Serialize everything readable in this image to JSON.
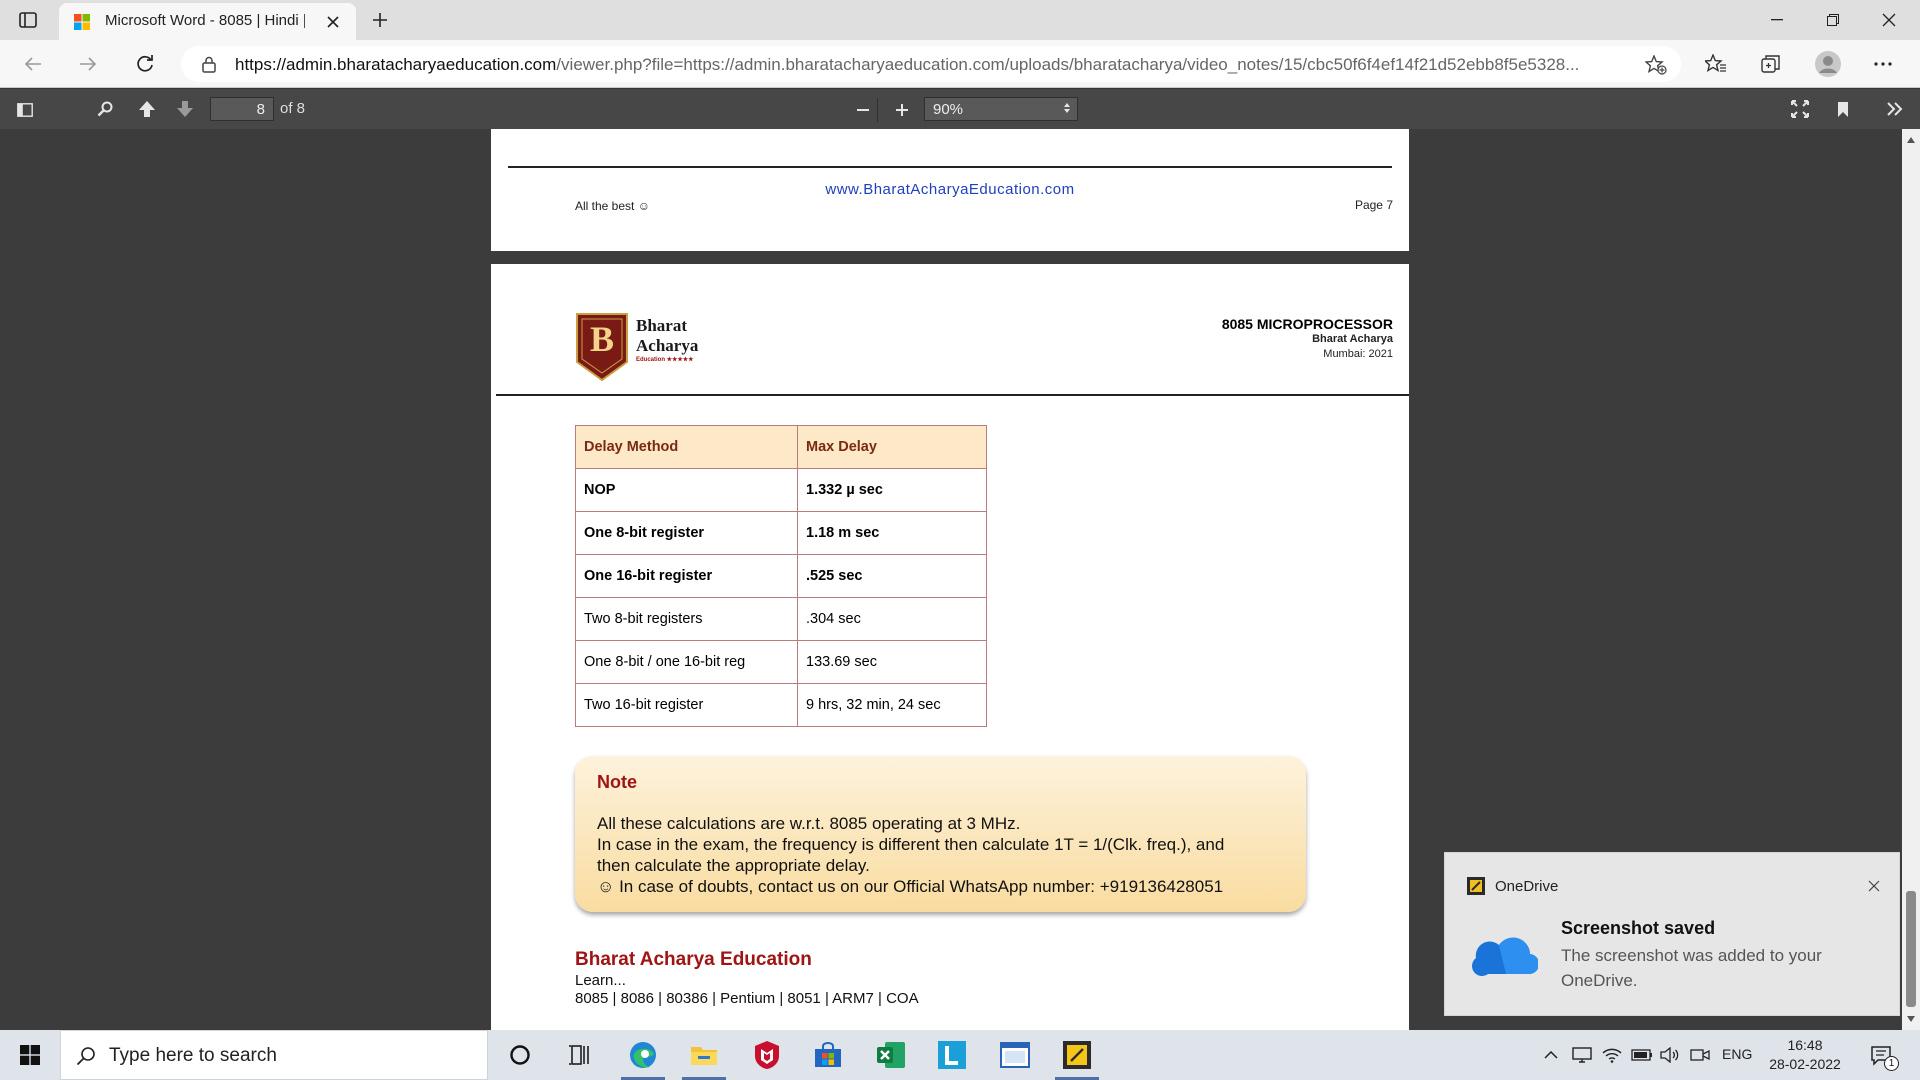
{
  "browser": {
    "tab_title": "Microsoft Word - 8085 | Hindi | D",
    "url_host": "https://admin.bharatacharyaeducation.com",
    "url_rest": "/viewer.php?file=https://admin.bharatacharyaeducation.com/uploads/bharatacharya/video_notes/15/cbc50f6f4ef14f21d52ebb8f5e5328..."
  },
  "pdf_toolbar": {
    "page_number": "8",
    "page_count": "of 8",
    "zoom": "90%"
  },
  "prev_page": {
    "footer_left": "All the best ☺",
    "footer_center": "www.BharatAcharyaEducation.com",
    "footer_right": "Page 7"
  },
  "page": {
    "logo": {
      "letter": "B",
      "line1": "Bharat",
      "line2": "Acharya",
      "line3": "Education ★★★★★"
    },
    "header": {
      "title": "8085 MICROPROCESSOR",
      "author": "Bharat Acharya",
      "place": "Mumbai: 2021"
    },
    "table": {
      "headers": [
        "Delay Method",
        "Max Delay"
      ],
      "rows": [
        [
          "NOP",
          "1.332 µ sec"
        ],
        [
          "One 8-bit register",
          "1.18 m sec"
        ],
        [
          "One 16-bit register",
          ".525 sec"
        ],
        [
          "Two 8-bit registers",
          ".304 sec"
        ],
        [
          "One 8-bit / one 16-bit reg",
          "133.69 sec"
        ],
        [
          "Two 16-bit register",
          "9 hrs, 32 min, 24 sec"
        ]
      ]
    },
    "note": {
      "title": "Note",
      "line1": "All these calculations are w.r.t. 8085 operating at 3 MHz.",
      "line2": "In case in the exam, the frequency is different then calculate 1T = 1/(Clk. freq.), and",
      "line3": "then calculate the appropriate delay.",
      "line4": "☺ In case of doubts, contact us on our Official WhatsApp number: +919136428051"
    },
    "footer": {
      "name": "Bharat Acharya Education",
      "learn": "Learn...",
      "courses": "8085 | 8086 | 80386 | Pentium | 8051 | ARM7 | COA"
    }
  },
  "toast": {
    "app": "OneDrive",
    "title": "Screenshot saved",
    "body_line1": "The screenshot was added to your",
    "body_line2": "OneDrive."
  },
  "taskbar": {
    "search_placeholder": "Type here to search",
    "language": "ENG",
    "time": "16:48",
    "date": "28-02-2022",
    "notification_count": "1"
  },
  "colors": {
    "accent_red": "#a01414",
    "link_blue": "#1f3fbf",
    "table_header_bg": "#fde8c8"
  }
}
